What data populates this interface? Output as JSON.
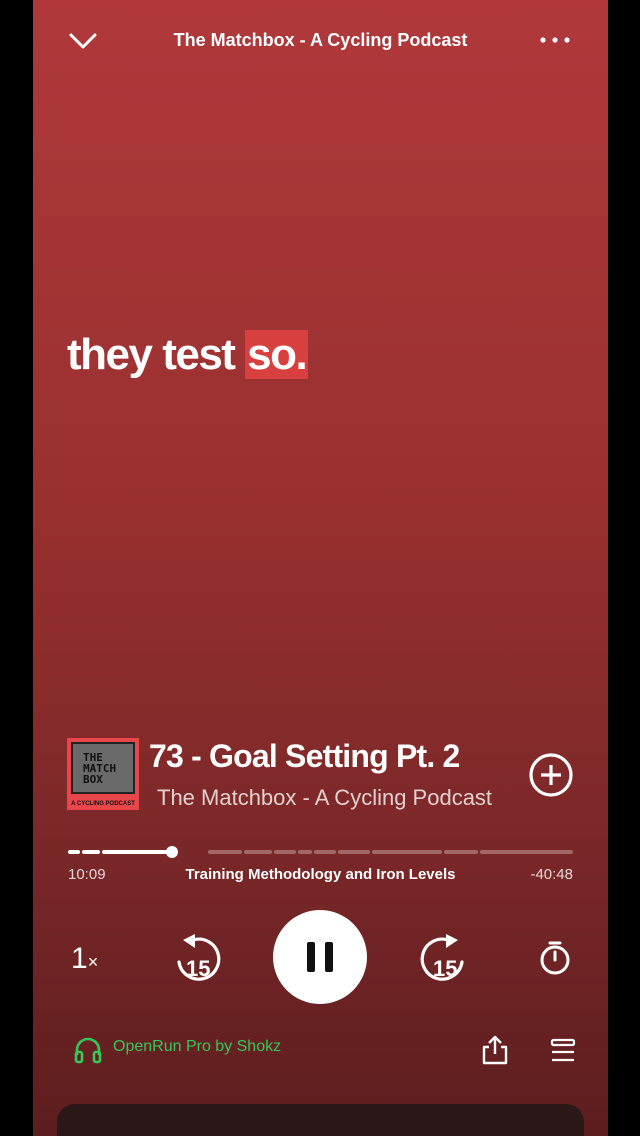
{
  "header": {
    "title": "The Matchbox - A Cycling Podcast"
  },
  "lyrics": {
    "normal": "they test ",
    "highlight": "so."
  },
  "artwork": {
    "line1": "THE",
    "line2": "MATCH",
    "line3": "BOX",
    "subtitle": "A CYCLING PODCAST"
  },
  "episode": {
    "title": "73 - Goal Setting Pt. 2",
    "show": "The Matchbox - A Cycling Podcast"
  },
  "progress": {
    "elapsed": "10:09",
    "remaining": "-40:48",
    "chapter": "Training Methodology and Iron Levels",
    "fraction": 0.2
  },
  "controls": {
    "speed": "1",
    "speed_unit": "×",
    "skip_back": "15",
    "skip_forward": "15"
  },
  "device": {
    "name": "OpenRun Pro by Shokz",
    "color": "#34c759"
  },
  "colors": {
    "background": "#a33434",
    "highlight": "#d8403f"
  }
}
